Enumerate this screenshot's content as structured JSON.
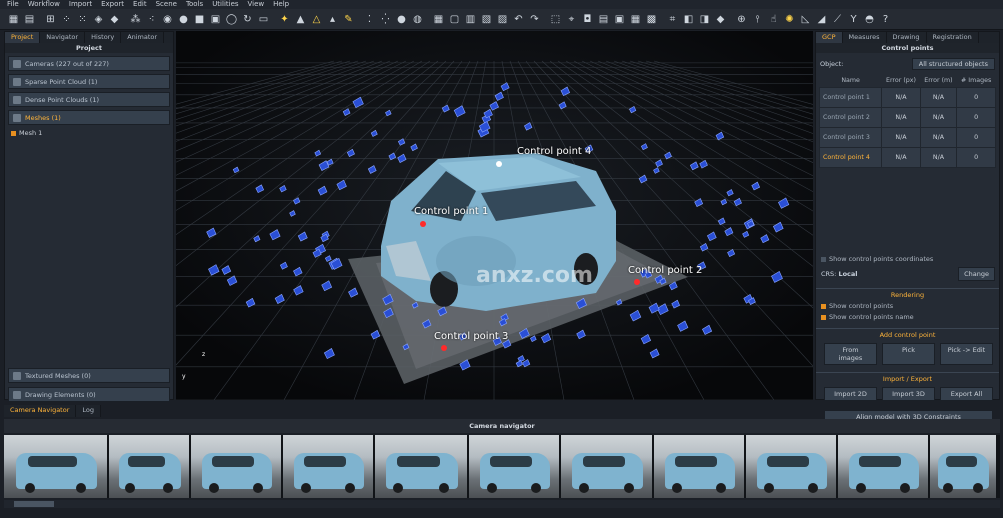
{
  "menu": [
    "File",
    "Workflow",
    "Import",
    "Export",
    "Edit",
    "Scene",
    "Tools",
    "Utilities",
    "View",
    "Help"
  ],
  "left_panel": {
    "tabs": [
      "Project",
      "Navigator",
      "History",
      "Animator"
    ],
    "active_tab": "Project",
    "header": "Project",
    "items": [
      {
        "label": "Cameras (227 out of 227)"
      },
      {
        "label": "Sparse Point Cloud (1)"
      },
      {
        "label": "Dense Point Clouds (1)"
      },
      {
        "label": "Meshes (1)"
      }
    ],
    "sub_item": "Mesh 1",
    "bottom_items": [
      {
        "label": "Textured Meshes (0)"
      },
      {
        "label": "Drawing Elements (0)"
      }
    ]
  },
  "viewport": {
    "control_points": [
      {
        "label": "Control point 4",
        "color": "#ffffff"
      },
      {
        "label": "Control point 1",
        "color": "#ff2a2a"
      },
      {
        "label": "Control point 2",
        "color": "#ff2a2a"
      },
      {
        "label": "Control point 3",
        "color": "#ff2a2a"
      }
    ],
    "watermark": "anxz.com",
    "axis_y": "y",
    "axis_z": "z"
  },
  "right_panel": {
    "tabs": [
      "GCP",
      "Measures",
      "Drawing",
      "Registration"
    ],
    "active_tab": "GCP",
    "header": "Control points",
    "object_label": "Object:",
    "object_value": "All structured objects",
    "columns": [
      "Name",
      "Error (px)",
      "Error (m)",
      "# Images"
    ],
    "rows": [
      {
        "name": "Control point 1",
        "err_px": "N/A",
        "err_m": "N/A",
        "images": "0"
      },
      {
        "name": "Control point 2",
        "err_px": "N/A",
        "err_m": "N/A",
        "images": "0"
      },
      {
        "name": "Control point 3",
        "err_px": "N/A",
        "err_m": "N/A",
        "images": "0"
      },
      {
        "name": "Control point 4",
        "err_px": "N/A",
        "err_m": "N/A",
        "images": "0"
      }
    ],
    "show_coords": "Show control points coordinates",
    "crs_label": "CRS:",
    "crs_value": "Local",
    "change_btn": "Change",
    "rendering_title": "Rendering",
    "show_points": "Show control points",
    "show_names": "Show control points name",
    "add_title": "Add control point",
    "from_images": "From images",
    "pick": "Pick",
    "pick_edit": "Pick -> Edit",
    "import_title": "Import / Export",
    "import_2d": "Import 2D",
    "import_3d": "Import 3D",
    "export_all": "Export All",
    "align_btn": "Align model with 3D Constraints"
  },
  "bottom": {
    "tabs": [
      "Camera Navigator",
      "Log"
    ],
    "active_tab": "Camera Navigator",
    "header": "Camera navigator",
    "thumb_count": 11
  },
  "accent_color": "#ffb43a"
}
